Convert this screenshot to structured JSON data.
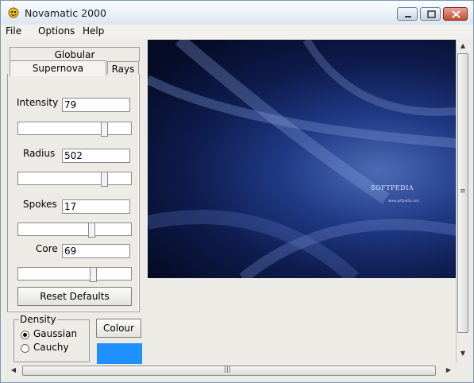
{
  "window": {
    "title": "Novamatic 2000"
  },
  "menu": {
    "items": [
      "File",
      "Options",
      "Help"
    ]
  },
  "tabs": {
    "globular": "Globular",
    "supernova": "Supernova",
    "rays": "Rays"
  },
  "params": [
    {
      "label": "Intensity",
      "value": "79",
      "slider_fraction": 0.78
    },
    {
      "label": "Radius",
      "value": "502",
      "slider_fraction": 0.78
    },
    {
      "label": "Spokes",
      "value": "17",
      "slider_fraction": 0.66
    },
    {
      "label": "Core",
      "value": "69",
      "slider_fraction": 0.68
    }
  ],
  "buttons": {
    "reset": "Reset Defaults",
    "colour": "Colour"
  },
  "density": {
    "title": "Density",
    "options": [
      "Gaussian",
      "Cauchy"
    ],
    "selected": "Gaussian"
  },
  "colour_swatch": "#1e90ff",
  "render": {
    "logo": "SOFTPEDIA",
    "url": "www.softpedia.com"
  },
  "scroll": {
    "grip": "≡"
  }
}
